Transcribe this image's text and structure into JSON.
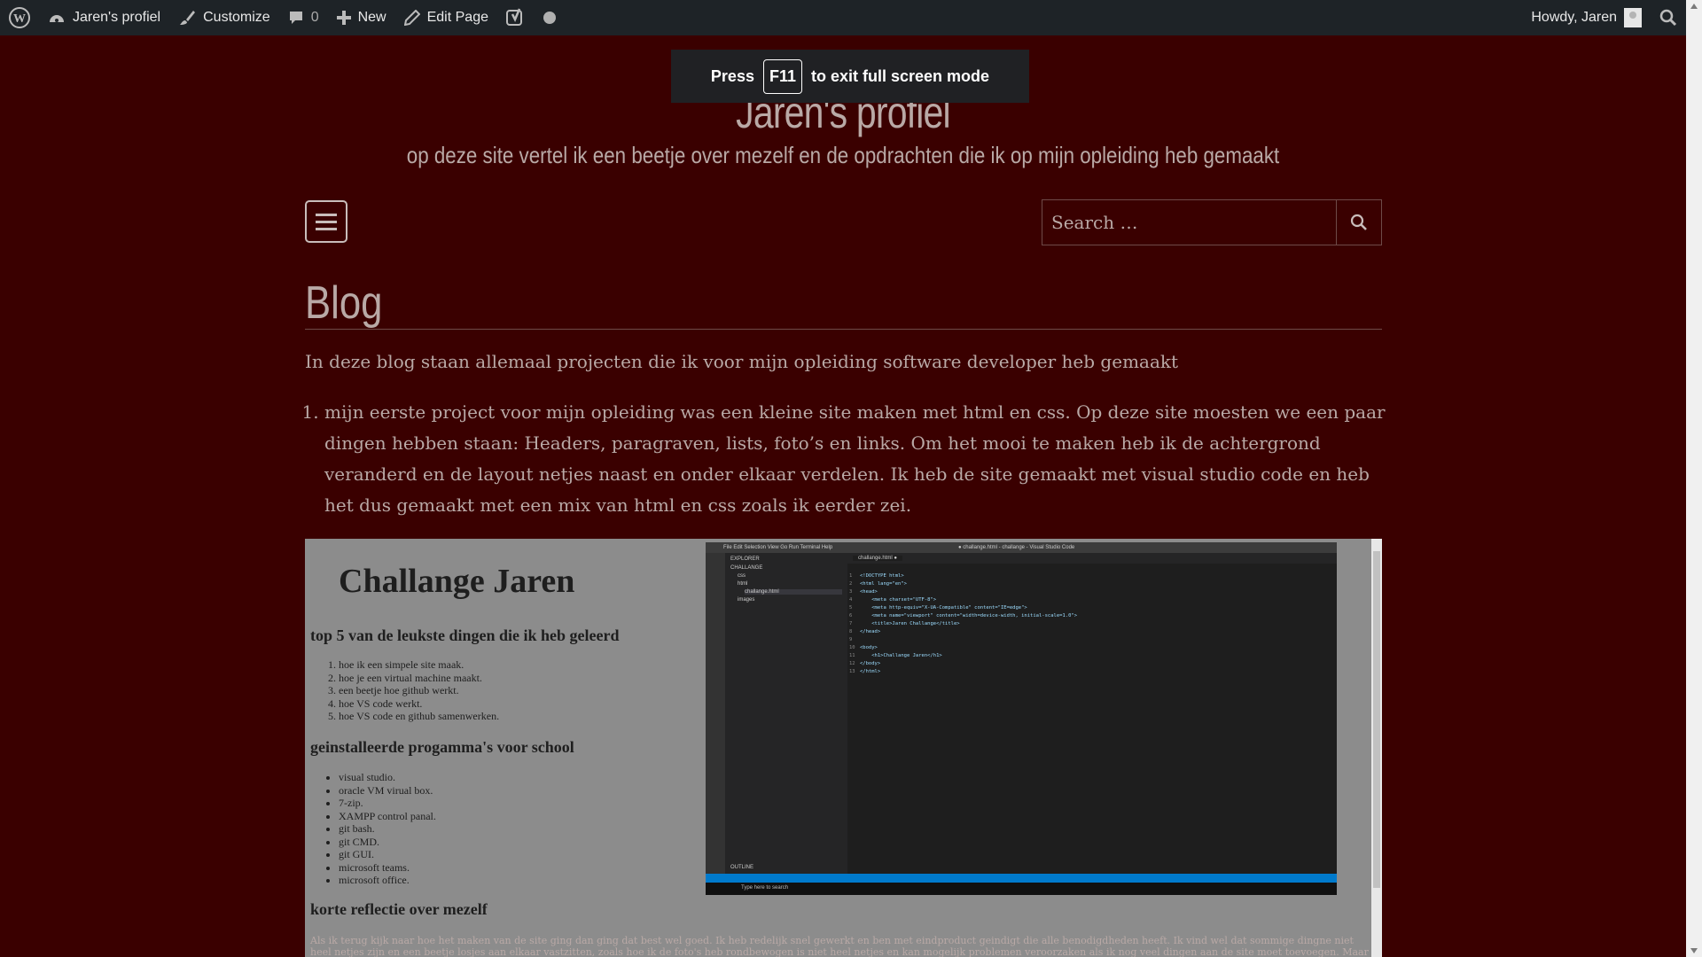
{
  "adminbar": {
    "site_name": "Jaren's profiel",
    "customize": "Customize",
    "comments_count": "0",
    "new": "New",
    "edit_page": "Edit Page",
    "howdy": "Howdy, Jaren"
  },
  "toast": {
    "press": "Press",
    "key": "F11",
    "rest": "to exit full screen mode"
  },
  "header": {
    "title": "Jaren's profiel",
    "description": "op deze site vertel ik een beetje over mezelf en de opdrachten die ik op mijn opleiding heb gemaakt"
  },
  "search": {
    "placeholder": "Search …"
  },
  "main": {
    "title": "Blog",
    "intro": "In deze blog staan allemaal projecten die ik voor mijn opleiding software developer heb gemaakt",
    "posts": [
      "mijn eerste project voor mijn opleiding was een kleine site maken met html en css. Op deze site moesten we een paar dingen hebben staan: Headers, paragraven, lists, foto’s en links. Om het mooi te maken heb ik de achtergrond veranderd en de layout netjes naast en onder elkaar verdelen. Ik heb de site gemaakt met visual studio code en heb het dus gemaakt met een mix van html en css zoals ik eerder zei."
    ]
  },
  "screenshot": {
    "h1": "Challange Jaren",
    "h2_1": "top 5 van de leukste dingen die ik heb geleerd",
    "list1": [
      "hoe ik een simpele site maak.",
      "hoe je een virtual machine maakt.",
      "een beetje hoe github werkt.",
      "hoe VS code werkt.",
      "hoe VS code en github samenwerken."
    ],
    "h2_2": "geinstalleerde progamma's voor school",
    "list2": [
      "visual studio.",
      "oracle VM virual box.",
      "7-zip.",
      "XAMPP control panal.",
      "git bash.",
      "git CMD.",
      "git GUI.",
      "microsoft teams.",
      "microsoft office."
    ],
    "h2_3": "korte reflectie over mezelf",
    "reflection": "Als ik terug kijk naar hoe het maken van de site ging dan ging dat best wel goed. Ik heb redelijk snel gewerkt en ben met eindproduct geindigt die alle benodigdheden heeft. Ik vind wel dat sommige dingne niet heel netjes zijn en een beetje losjes aan elkaar vastzitten, zoals hoe ik de foto's heb rondbewogen is niet heel netjes en kan mogelijk problemen veroorzaken als ik nog veel dingen aan de site moet toevoegen. Maar overal vond ik het toch best wel goed gaan.",
    "vscode": {
      "menu": "File  Edit  Selection  View  Go  Run  Terminal  Help",
      "window_title": "● challange.html - challange - Visual Studio Code",
      "explorer": "EXPLORER",
      "folder": "CHALLANGE",
      "tree": [
        "css",
        "html",
        "challange.html",
        "images"
      ],
      "tab": "challange.html ●",
      "outline": "OUTLINE",
      "taskbar_search": "Type here to search",
      "code": "<!DOCTYPE html>\n<html lang=\"en\">\n<head>\n    <meta charset=\"UTF-8\">\n    <meta http-equiv=\"X-UA-Compatible\" content=\"IE=edge\">\n    <meta name=\"viewport\" content=\"width=device-width, initial-scale=1.0\">\n    <title>Jaren Challange</title>\n</head>\n\n<body>\n    <h1>Challange Jaren</h1>\n</body>\n</html>",
      "line_numbers": "1\n2\n3\n4\n5\n6\n7\n8\n9\n10\n11\n12\n13"
    }
  }
}
